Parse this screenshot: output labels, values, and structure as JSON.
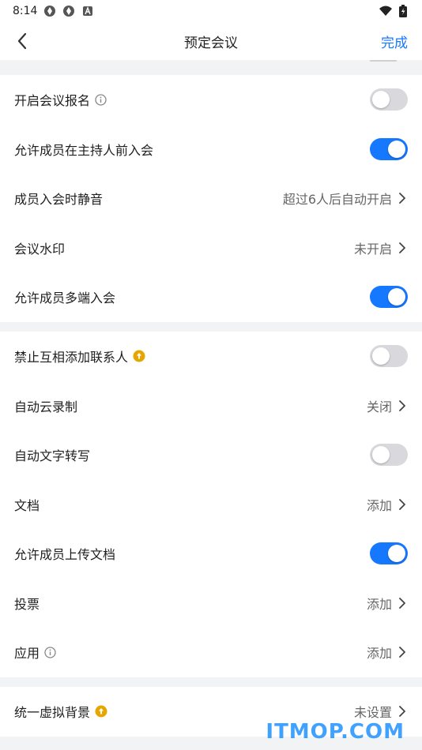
{
  "status_bar": {
    "time": "8:14"
  },
  "nav": {
    "title": "预定会议",
    "done_label": "完成"
  },
  "groups": [
    {
      "rows": [
        {
          "label": "开启会议报名",
          "has_info": true,
          "toggle": false
        },
        {
          "label": "允许成员在主持人前入会",
          "toggle": true
        },
        {
          "label": "成员入会时静音",
          "value": "超过6人后自动开启"
        },
        {
          "label": "会议水印",
          "value": "未开启"
        },
        {
          "label": "允许成员多端入会",
          "toggle": true
        }
      ]
    },
    {
      "rows": [
        {
          "label": "禁止互相添加联系人",
          "has_upgrade": true,
          "toggle": false
        },
        {
          "label": "自动云录制",
          "value": "关闭"
        },
        {
          "label": "自动文字转写",
          "toggle": false
        },
        {
          "label": "文档",
          "value": "添加"
        },
        {
          "label": "允许成员上传文档",
          "toggle": true
        },
        {
          "label": "投票",
          "value": "添加"
        },
        {
          "label": "应用",
          "has_info": true,
          "value": "添加"
        }
      ]
    },
    {
      "rows": [
        {
          "label": "统一虚拟背景",
          "has_upgrade": true,
          "value": "未设置"
        }
      ]
    }
  ],
  "colors": {
    "accent": "#1677ff",
    "upgrade": "#e6a600"
  },
  "watermark": "ITMOP.COM"
}
